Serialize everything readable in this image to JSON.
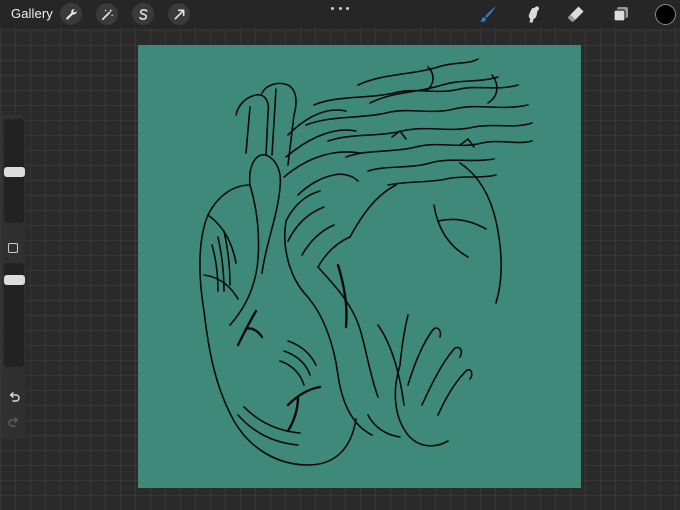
{
  "topbar": {
    "gallery_label": "Gallery",
    "left_tools": [
      {
        "name": "actions",
        "icon": "wrench-icon"
      },
      {
        "name": "adjustments",
        "icon": "magic-wand-icon"
      },
      {
        "name": "selection",
        "icon": "selection-s-icon"
      },
      {
        "name": "transform",
        "icon": "transform-arrow-icon"
      }
    ],
    "more_icon": "ellipsis-icon",
    "right_tools": [
      {
        "name": "brush",
        "icon": "brush-icon",
        "active": true
      },
      {
        "name": "smudge",
        "icon": "smudge-icon",
        "active": false
      },
      {
        "name": "eraser",
        "icon": "eraser-icon",
        "active": false
      },
      {
        "name": "layers",
        "icon": "layers-icon",
        "active": false
      }
    ],
    "current_color": "#000000",
    "active_tool_color": "#2f7dd6"
  },
  "sidebar": {
    "brush_size_icon": "brush-size-slider",
    "opacity_icon": "opacity-slider",
    "modify_icon": "square-modify-icon",
    "undo_icon": "undo-icon",
    "redo_icon": "redo-icon"
  },
  "canvas": {
    "background_color": "#3f897a",
    "artwork": "line-art-heart-with-hands-icon"
  }
}
